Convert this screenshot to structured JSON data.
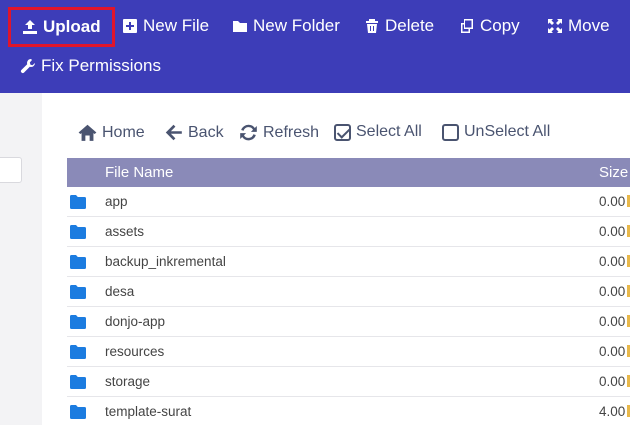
{
  "toolbar": {
    "upload": "Upload",
    "new_file": "New File",
    "new_folder": "New Folder",
    "delete": "Delete",
    "copy": "Copy",
    "move": "Move",
    "fix_permissions": "Fix Permissions"
  },
  "actions": {
    "home": "Home",
    "back": "Back",
    "refresh": "Refresh",
    "select_all": "Select All",
    "unselect_all": "UnSelect All"
  },
  "table": {
    "columns": {
      "name": "File Name",
      "size": "Size"
    },
    "rows": [
      {
        "name": "app",
        "size": "0.00"
      },
      {
        "name": "assets",
        "size": "0.00"
      },
      {
        "name": "backup_inkremental",
        "size": "0.00"
      },
      {
        "name": "desa",
        "size": "0.00"
      },
      {
        "name": "donjo-app",
        "size": "0.00"
      },
      {
        "name": "resources",
        "size": "0.00"
      },
      {
        "name": "storage",
        "size": "0.00"
      },
      {
        "name": "template-surat",
        "size": "4.00"
      }
    ]
  },
  "colors": {
    "toolbar_bg": "#3d3db8",
    "highlight_border": "#e0152b",
    "table_header_bg": "#8a8ab8",
    "folder_icon": "#1c7ce0"
  }
}
